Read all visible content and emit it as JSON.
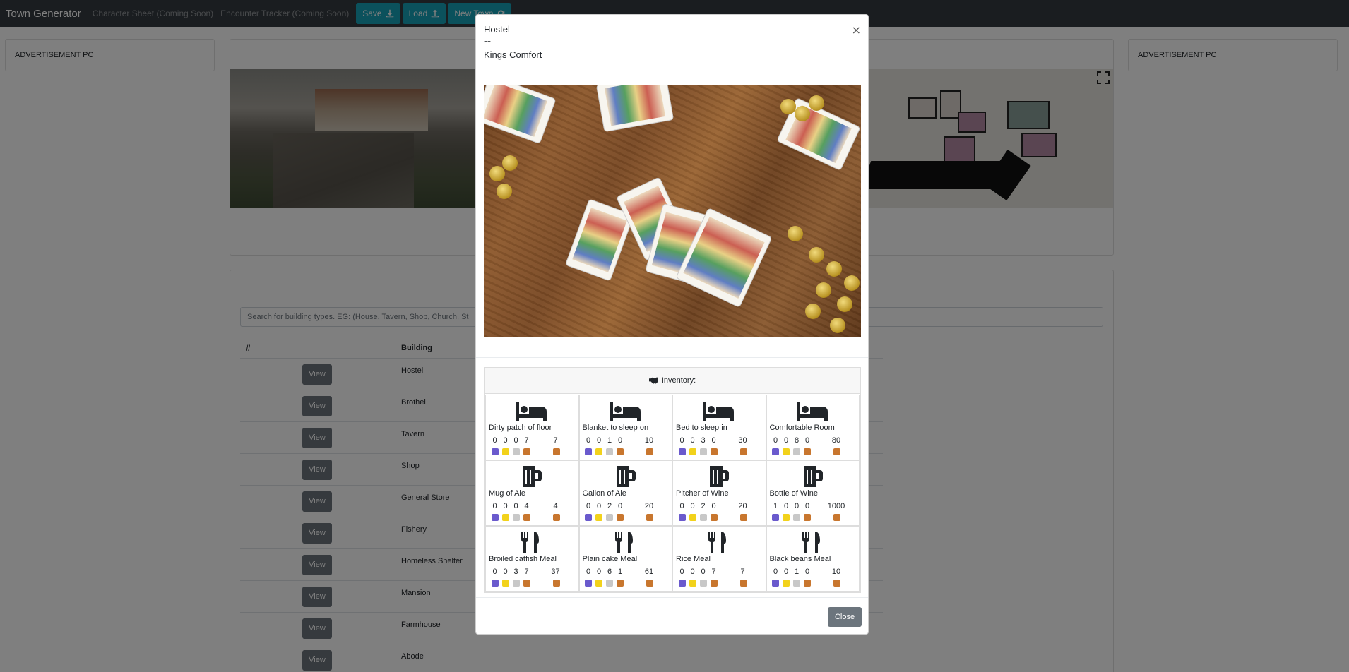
{
  "navbar": {
    "brand": "Town Generator",
    "links": [
      "Character Sheet (Coming Soon)",
      "Encounter Tracker (Coming Soon)"
    ],
    "buttons": [
      "Save",
      "Load",
      "New Town"
    ]
  },
  "ads": {
    "left": "ADVERTISEMENT PC",
    "right": "ADVERTISEMENT PC"
  },
  "search": {
    "placeholder": "Search for building types. EG: (House, Tavern, Shop, Church, St"
  },
  "table": {
    "headers": [
      "#",
      "Building"
    ],
    "view_label": "View",
    "rows": [
      "Hostel",
      "Brothel",
      "Tavern",
      "Shop",
      "General Store",
      "Fishery",
      "Homeless Shelter",
      "Mansion",
      "Farmhouse",
      "Abode"
    ]
  },
  "modal": {
    "title": "Hostel",
    "separator": "--",
    "name": "Kings Comfort",
    "close_x": "×",
    "inventory_label": "Inventory:",
    "close_button": "Close",
    "coin_colors": [
      "#6a5acd",
      "#f2d21b",
      "#c8c8c8",
      "#c8762e"
    ],
    "items": [
      {
        "icon": "bed-icon",
        "name": "Dirty patch of floor",
        "digits": [
          "0",
          "0",
          "0",
          "7"
        ],
        "total": "7"
      },
      {
        "icon": "bed-icon",
        "name": "Blanket to sleep on",
        "digits": [
          "0",
          "0",
          "1",
          "0"
        ],
        "total": "10"
      },
      {
        "icon": "bed-icon",
        "name": "Bed to sleep in",
        "digits": [
          "0",
          "0",
          "3",
          "0"
        ],
        "total": "30"
      },
      {
        "icon": "bed-icon",
        "name": "Comfortable Room",
        "digits": [
          "0",
          "0",
          "8",
          "0"
        ],
        "total": "80"
      },
      {
        "icon": "beer-mug-icon",
        "name": "Mug of Ale",
        "digits": [
          "0",
          "0",
          "0",
          "4"
        ],
        "total": "4"
      },
      {
        "icon": "beer-mug-icon",
        "name": "Gallon of Ale",
        "digits": [
          "0",
          "0",
          "2",
          "0"
        ],
        "total": "20"
      },
      {
        "icon": "beer-mug-icon",
        "name": "Pitcher of Wine",
        "digits": [
          "0",
          "0",
          "2",
          "0"
        ],
        "total": "20"
      },
      {
        "icon": "beer-mug-icon",
        "name": "Bottle of Wine",
        "digits": [
          "1",
          "0",
          "0",
          "0"
        ],
        "total": "1000"
      },
      {
        "icon": "utensils-icon",
        "name": "Broiled catfish Meal",
        "digits": [
          "0",
          "0",
          "3",
          "7"
        ],
        "total": "37"
      },
      {
        "icon": "utensils-icon",
        "name": "Plain cake Meal",
        "digits": [
          "0",
          "0",
          "6",
          "1"
        ],
        "total": "61"
      },
      {
        "icon": "utensils-icon",
        "name": "Rice Meal",
        "digits": [
          "0",
          "0",
          "0",
          "7"
        ],
        "total": "7"
      },
      {
        "icon": "utensils-icon",
        "name": "Black beans Meal",
        "digits": [
          "0",
          "0",
          "1",
          "0"
        ],
        "total": "10"
      }
    ]
  }
}
